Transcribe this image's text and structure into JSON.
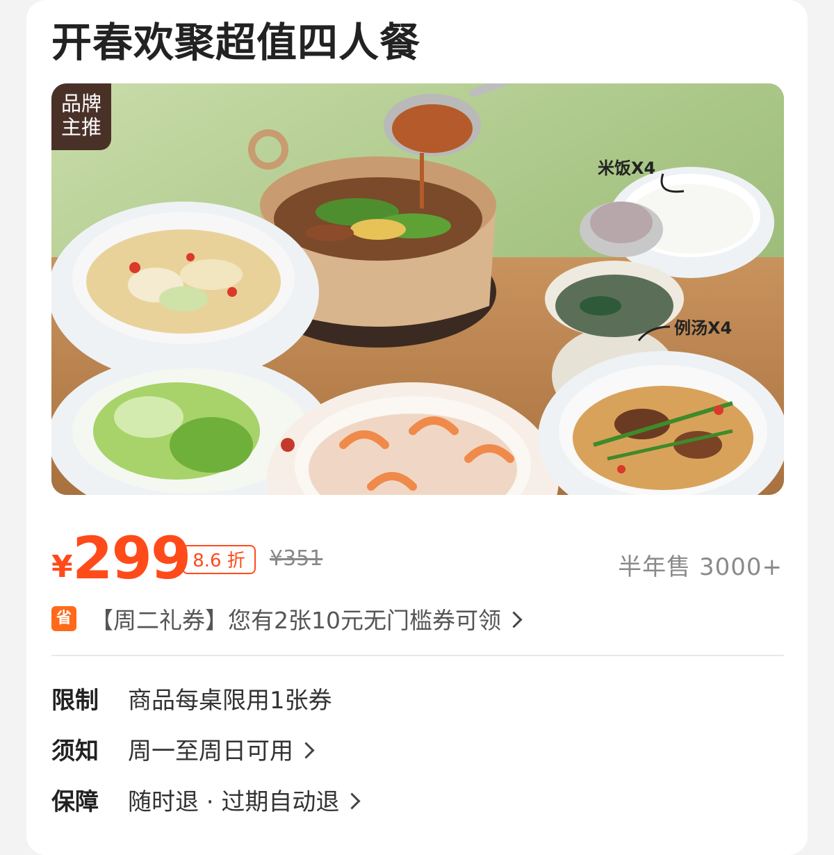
{
  "title": "开春欢聚超值四人餐",
  "hero": {
    "badge_line1": "品牌",
    "badge_line2": "主推",
    "label_rice": "米饭X4",
    "label_soup": "例汤X4"
  },
  "price": {
    "currency": "¥",
    "amount": "299",
    "discount": "8.6 折",
    "original": "¥351",
    "sales": "半年售 3000+"
  },
  "coupon": {
    "icon_text": "省",
    "text": "【周二礼券】您有2张10元无门槛券可领"
  },
  "info": [
    {
      "label": "限制",
      "value": "商品每桌限用1张券",
      "has_arrow": false
    },
    {
      "label": "须知",
      "value": "周一至周日可用",
      "has_arrow": true
    },
    {
      "label": "保障",
      "value": "随时退 · 过期自动退",
      "has_arrow": true
    }
  ],
  "colors": {
    "accent": "#ff4a1a",
    "badge_bg": "#4a3128",
    "save_icon": "#ff6a1a"
  }
}
